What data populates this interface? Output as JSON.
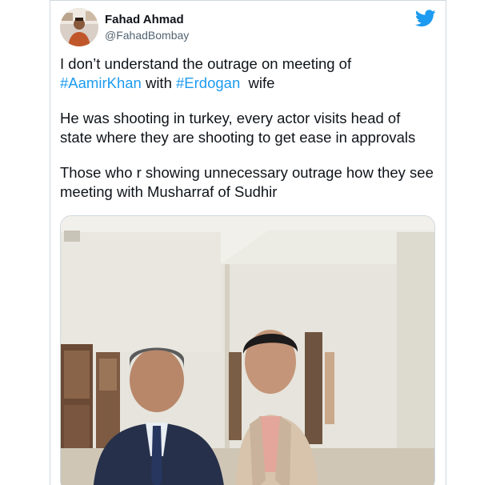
{
  "tweet": {
    "author": {
      "display_name": "Fahad Ahmad",
      "handle": "@FahadBombay",
      "avatar_icon": "avatar"
    },
    "brand_icon": "twitter-bird-icon",
    "brand_color": "#1d9bf0",
    "text": {
      "p1_a": "I don’t understand the outrage on meeting of ",
      "p1_tag1": "#AamirKhan",
      "p1_b": " with ",
      "p1_tag2": "#Erdogan",
      "p1_c": "  wife",
      "p2": "He was shooting in turkey, every actor visits head of state where they are shooting to get ease in approvals",
      "p3": "Those who r showing unnecessary outrage how they see meeting with Musharraf of Sudhir"
    },
    "media": {
      "type": "photo",
      "alt_icon": "photo"
    }
  }
}
